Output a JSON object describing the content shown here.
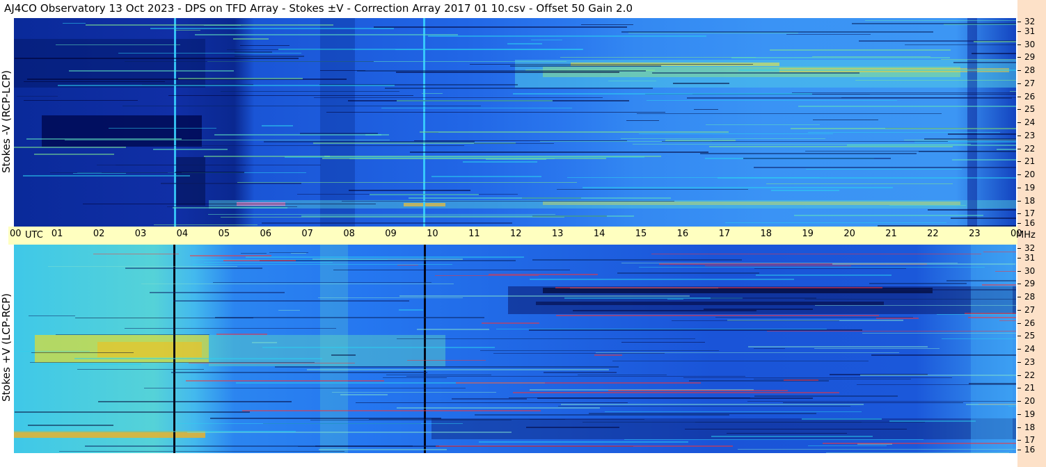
{
  "title": "AJ4CO Observatory  13 Oct 2023  -  DPS on TFD Array  -  Stokes ±V  -  Correction Array 2017 01 10.csv  -  Offset 50  Gain 2.0",
  "colors": {
    "background": "#ffffff",
    "time_axis": "#ffffc0",
    "right_strip": "#fde1c8"
  },
  "chart_data": [
    {
      "type": "heatmap",
      "panel": "top",
      "ylabel": "Stokes -V (RCP-LCP)",
      "x_ticks": [
        "00",
        "01",
        "02",
        "03",
        "04",
        "05",
        "06",
        "07",
        "08",
        "09",
        "10",
        "11",
        "12",
        "13",
        "14",
        "15",
        "16",
        "17",
        "18",
        "19",
        "20",
        "21",
        "22",
        "23",
        "00"
      ],
      "x_unit": "UTC",
      "y_ticks": [
        "16",
        "17",
        "18",
        "19",
        "20",
        "21",
        "22",
        "23",
        "24",
        "25",
        "26",
        "27",
        "28",
        "29",
        "30",
        "31",
        "32"
      ],
      "y_unit": "MHz",
      "ylim": [
        16,
        32
      ]
    },
    {
      "type": "heatmap",
      "panel": "bottom",
      "ylabel": "Stokes +V (LCP-RCP)",
      "x_ticks": [
        "00",
        "01",
        "02",
        "03",
        "04",
        "05",
        "06",
        "07",
        "08",
        "09",
        "10",
        "11",
        "12",
        "13",
        "14",
        "15",
        "16",
        "17",
        "18",
        "19",
        "20",
        "21",
        "22",
        "23",
        "00"
      ],
      "x_unit": "UTC",
      "y_ticks": [
        "16",
        "17",
        "18",
        "19",
        "20",
        "21",
        "22",
        "23",
        "24",
        "25",
        "26",
        "27",
        "28",
        "29",
        "30",
        "31",
        "32"
      ],
      "y_unit": "MHz",
      "ylim": [
        16,
        32
      ]
    }
  ]
}
